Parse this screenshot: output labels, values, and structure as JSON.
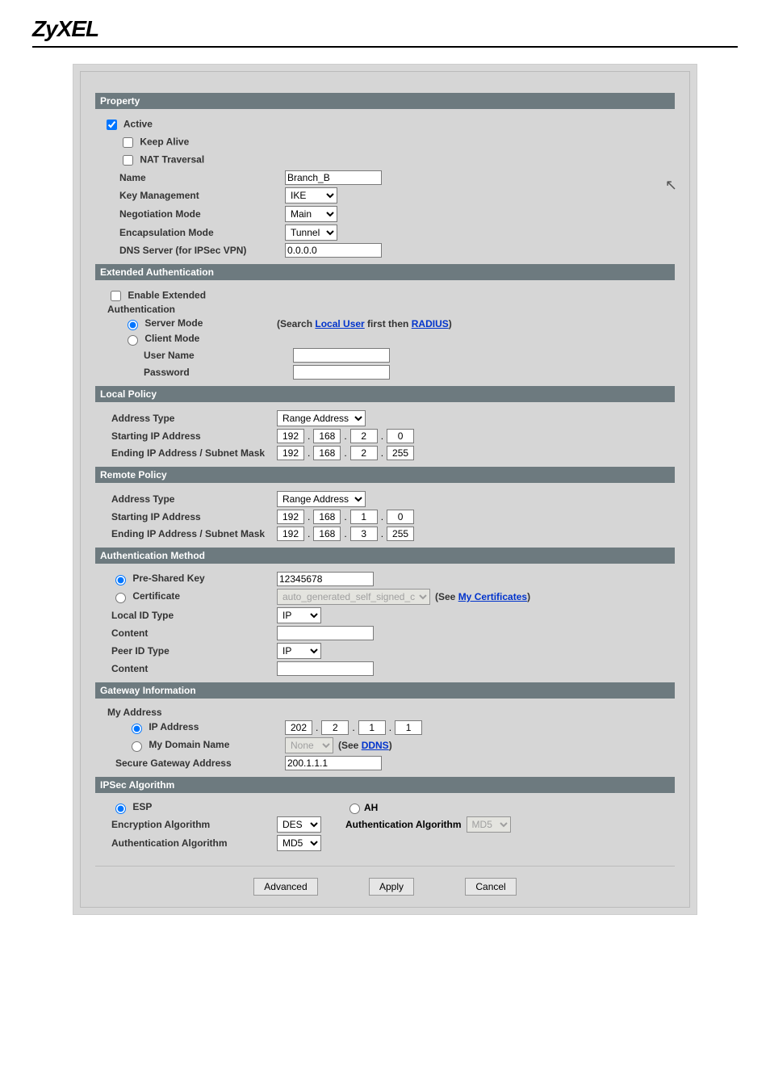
{
  "brand": "ZyXEL",
  "headers": {
    "property": "Property",
    "ext_auth": "Extended Authentication",
    "local_policy": "Local Policy",
    "remote_policy": "Remote Policy",
    "auth_method": "Authentication Method",
    "gateway_info": "Gateway Information",
    "ipsec_alg": "IPSec Algorithm"
  },
  "property": {
    "active": "Active",
    "keep_alive": "Keep Alive",
    "nat_traversal": "NAT Traversal",
    "name_label": "Name",
    "name_value": "Branch_B",
    "key_mgmt_label": "Key Management",
    "key_mgmt_value": "IKE",
    "neg_mode_label": "Negotiation Mode",
    "neg_mode_value": "Main",
    "encap_label": "Encapsulation Mode",
    "encap_value": "Tunnel",
    "dns_label": "DNS Server (for IPSec VPN)",
    "dns_value": "0.0.0.0"
  },
  "ext_auth": {
    "enable": "Enable Extended Authentication",
    "server_mode": "Server Mode",
    "server_hint_pre": "(Search ",
    "server_hint_link1": "Local User",
    "server_hint_mid": " first then ",
    "server_hint_link2": "RADIUS",
    "server_hint_post": ")",
    "client_mode": "Client Mode",
    "user_label": "User Name",
    "pass_label": "Password"
  },
  "local_policy": {
    "addr_type_label": "Address Type",
    "addr_type_value": "Range Address",
    "start_label": "Starting IP Address",
    "start_ip": {
      "a": "192",
      "b": "168",
      "c": "2",
      "d": "0"
    },
    "end_label": "Ending IP Address / Subnet Mask",
    "end_ip": {
      "a": "192",
      "b": "168",
      "c": "2",
      "d": "255"
    }
  },
  "remote_policy": {
    "addr_type_label": "Address Type",
    "addr_type_value": "Range Address",
    "start_label": "Starting IP Address",
    "start_ip": {
      "a": "192",
      "b": "168",
      "c": "1",
      "d": "0"
    },
    "end_label": "Ending IP Address / Subnet Mask",
    "end_ip": {
      "a": "192",
      "b": "168",
      "c": "3",
      "d": "255"
    }
  },
  "auth_method": {
    "psk_label": "Pre-Shared Key",
    "psk_value": "12345678",
    "cert_label": "Certificate",
    "cert_value": "auto_generated_self_signed_cert",
    "cert_hint_pre": "(See ",
    "cert_hint_link": "My Certificates",
    "cert_hint_post": ")",
    "local_id_label": "Local ID Type",
    "local_id_value": "IP",
    "content_label": "Content",
    "peer_id_label": "Peer ID Type",
    "peer_id_value": "IP",
    "content2_label": "Content"
  },
  "gateway": {
    "my_addr_label": "My Address",
    "ip_addr_label": "IP Address",
    "ip_addr": {
      "a": "202",
      "b": "2",
      "c": "1",
      "d": "1"
    },
    "domain_label": "My Domain Name",
    "domain_value": "None",
    "ddns_pre": "(See ",
    "ddns_link": "DDNS",
    "ddns_post": ")",
    "secure_gw_label": "Secure Gateway Address",
    "secure_gw_value": "200.1.1.1"
  },
  "ipsec": {
    "esp": "ESP",
    "ah": "AH",
    "enc_label": "Encryption Algorithm",
    "enc_value": "DES",
    "auth_alg_label": "Authentication Algorithm",
    "auth_alg_value": "MD5",
    "auth_label2": "Authentication Algorithm",
    "auth_value2": "MD5"
  },
  "buttons": {
    "advanced": "Advanced",
    "apply": "Apply",
    "cancel": "Cancel"
  }
}
